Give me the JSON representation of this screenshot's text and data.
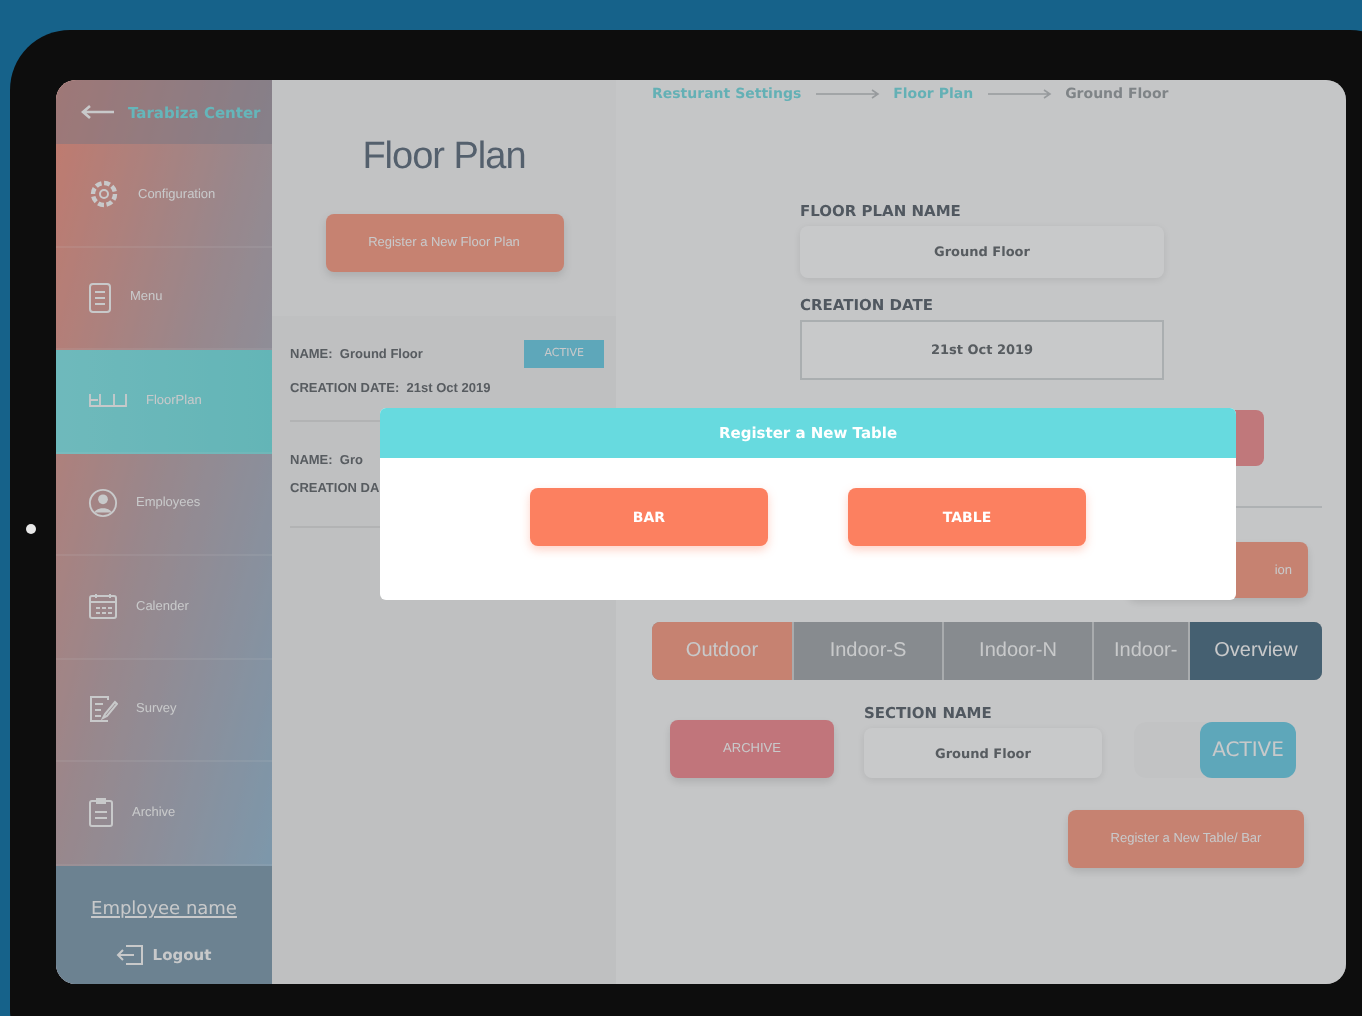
{
  "sidebar": {
    "back_label": "Tarabiza Center",
    "items": [
      {
        "label": "Configuration",
        "selected": false
      },
      {
        "label": "Menu",
        "selected": false
      },
      {
        "label": "FloorPlan",
        "selected": true
      },
      {
        "label": "Employees",
        "selected": false
      },
      {
        "label": "Calender",
        "selected": false
      },
      {
        "label": "Survey",
        "selected": false
      },
      {
        "label": "Archive",
        "selected": false
      }
    ],
    "employee_name": "Employee name",
    "logout": "Logout"
  },
  "floor_plans": {
    "title": "Floor Plan",
    "register_button": "Register a New Floor Plan",
    "items": [
      {
        "name_label": "NAME:",
        "name": "Ground Floor",
        "date_label": "CREATION DATE:",
        "date": "21st Oct 2019",
        "status": "ACTIVE"
      },
      {
        "name_label": "NAME:",
        "name": "Gro",
        "date_label": "CREATION DA"
      }
    ]
  },
  "breadcrumb": [
    {
      "label": "Resturant Settings",
      "current": false
    },
    {
      "label": "Floor Plan",
      "current": false
    },
    {
      "label": "Ground Floor",
      "current": true
    }
  ],
  "floor_plan_name": {
    "label": "FLOOR PLAN NAME",
    "value": "Ground Floor"
  },
  "creation_date": {
    "label": "CREATION DATE",
    "value": "21st Oct 2019"
  },
  "section_button": "ion",
  "tabs": [
    {
      "label": "Outdoor",
      "selected": true
    },
    {
      "label": "Indoor-S",
      "selected": false
    },
    {
      "label": "Indoor-N",
      "selected": false
    },
    {
      "label": "Indoor-",
      "selected": false
    }
  ],
  "overview_button": "Overview",
  "archive_button": "ARCHIVE",
  "section_name": {
    "label": "SECTION NAME",
    "value": "Ground Floor"
  },
  "status_toggle": {
    "label": "ACTIVE",
    "on": true
  },
  "register_table_button": "Register a New Table/ Bar",
  "modal": {
    "title": "Register a New Table",
    "buttons": [
      "BAR",
      "TABLE"
    ]
  }
}
